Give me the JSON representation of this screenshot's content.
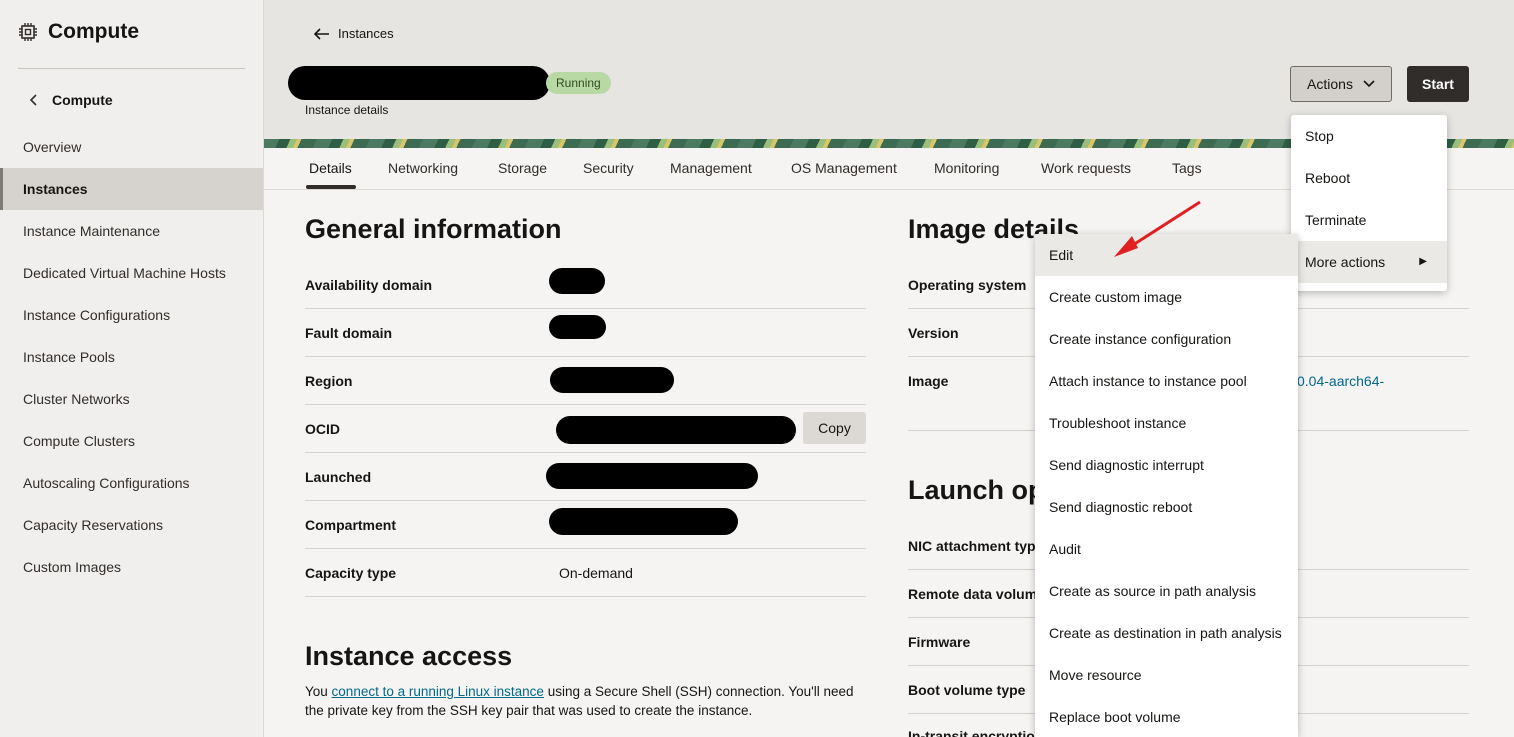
{
  "sidebar": {
    "title": "Compute",
    "back_label": "Compute",
    "items": [
      {
        "label": "Overview",
        "active": false
      },
      {
        "label": "Instances",
        "active": true
      },
      {
        "label": "Instance Maintenance",
        "active": false
      },
      {
        "label": "Dedicated Virtual Machine Hosts",
        "active": false
      },
      {
        "label": "Instance Configurations",
        "active": false
      },
      {
        "label": "Instance Pools",
        "active": false
      },
      {
        "label": "Cluster Networks",
        "active": false
      },
      {
        "label": "Compute Clusters",
        "active": false
      },
      {
        "label": "Autoscaling Configurations",
        "active": false
      },
      {
        "label": "Capacity Reservations",
        "active": false
      },
      {
        "label": "Custom Images",
        "active": false
      }
    ]
  },
  "header": {
    "back_label": "Instances",
    "status": "Running",
    "subtitle": "Instance details",
    "actions_label": "Actions",
    "start_label": "Start"
  },
  "tabs": [
    "Details",
    "Networking",
    "Storage",
    "Security",
    "Management",
    "OS Management",
    "Monitoring",
    "Work requests",
    "Tags"
  ],
  "general": {
    "title": "General information",
    "rows": [
      {
        "label": "Availability domain",
        "value": ""
      },
      {
        "label": "Fault domain",
        "value": ""
      },
      {
        "label": "Region",
        "value": ""
      },
      {
        "label": "OCID",
        "value": ""
      },
      {
        "label": "Launched",
        "value": ""
      },
      {
        "label": "Compartment",
        "value": ""
      },
      {
        "label": "Capacity type",
        "value": "On-demand"
      }
    ],
    "copy_label": "Copy"
  },
  "access": {
    "title": "Instance access",
    "text_before": "You ",
    "link": "connect to a running Linux instance",
    "text_after": " using a Secure Shell (SSH) connection. You'll need the private key from the SSH key pair that was used to create the instance."
  },
  "image": {
    "title": "Image details",
    "rows": [
      "Operating system",
      "Version",
      "Image"
    ],
    "image_value_fragment": "0.04-aarch64-"
  },
  "launch": {
    "title": "Launch op",
    "rows": [
      "NIC attachment typ",
      "Remote data volum",
      "Firmware",
      "Boot volume type",
      "In-transit encryptio"
    ]
  },
  "actions_menu": {
    "items": [
      "Stop",
      "Reboot",
      "Terminate",
      "More actions"
    ]
  },
  "more_actions_menu": {
    "items": [
      "Edit",
      "Create custom image",
      "Create instance configuration",
      "Attach instance to instance pool",
      "Troubleshoot instance",
      "Send diagnostic interrupt",
      "Send diagnostic reboot",
      "Audit",
      "Create as source in path analysis",
      "Create as destination in path analysis",
      "Move resource",
      "Replace boot volume"
    ]
  },
  "colors": {
    "accent_link": "#00688c",
    "status_badge": "#b8d9a4",
    "arrow": "#e02020"
  }
}
